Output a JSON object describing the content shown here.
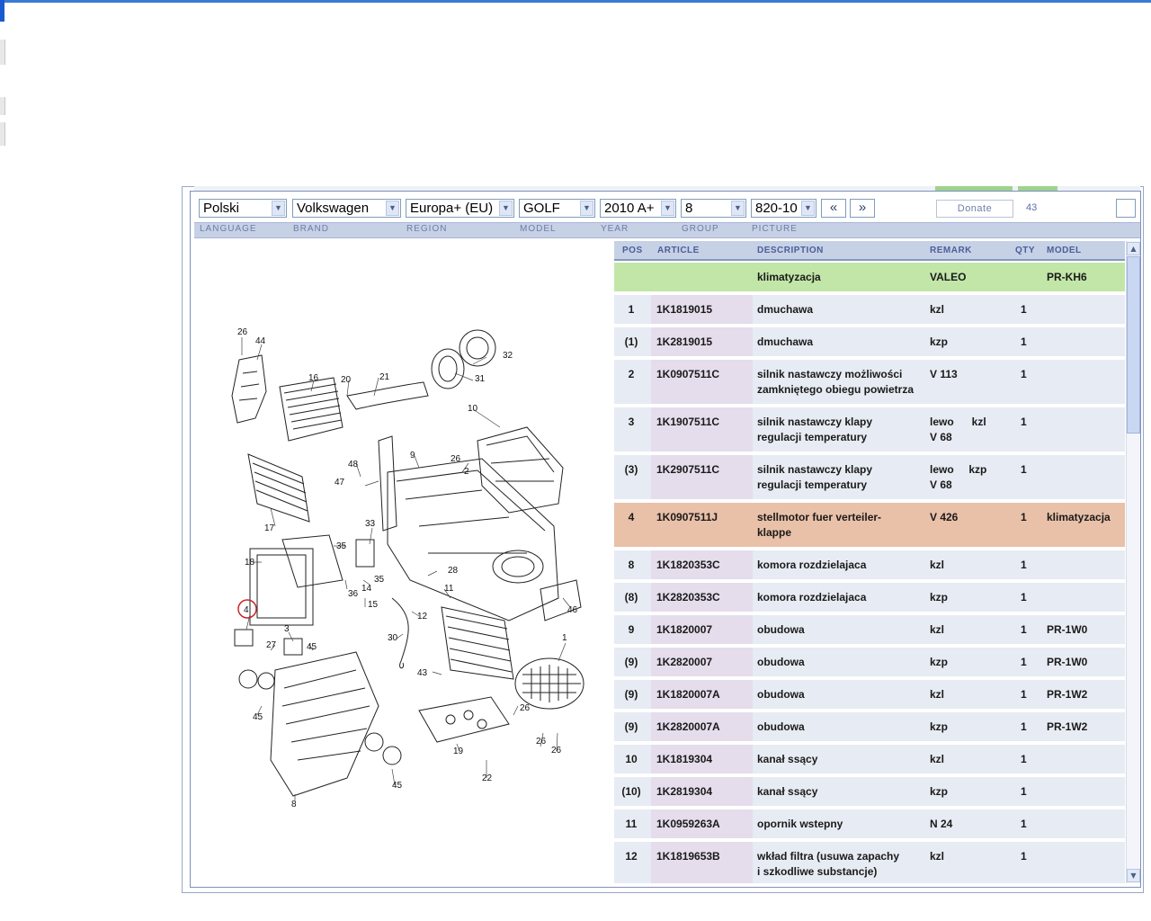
{
  "toolbar": {
    "language": "Polski",
    "brand": "Volkswagen",
    "region": "Europa+ (EU)",
    "model": "GOLF",
    "year": "2010  A+",
    "group": "8",
    "picture": "820-10",
    "prev_label": "«",
    "next_label": "»",
    "donate_label": "Donate",
    "count": "43"
  },
  "labels": {
    "language": "LANGUAGE",
    "brand": "BRAND",
    "region": "REGION",
    "model": "MODEL",
    "year": "YEAR",
    "group": "GROUP",
    "picture": "PICTURE"
  },
  "table": {
    "headers": {
      "pos": "POS",
      "article": "ARTICLE",
      "description": "DESCRIPTION",
      "remark": "REMARK",
      "qty": "QTY",
      "model": "MODEL"
    },
    "rows": [
      {
        "pos": "",
        "article": "",
        "desc1": "klimatyzacja",
        "desc2": "",
        "remark1": "VALEO",
        "remark2": "",
        "qty": "",
        "model": "PR-KH6"
      },
      {
        "pos": "1",
        "article": "1K1819015",
        "desc1": "dmuchawa",
        "desc2": "",
        "remark1": "kzl",
        "remark2": "",
        "qty": "1",
        "model": ""
      },
      {
        "pos": "(1)",
        "article": "1K2819015",
        "desc1": "dmuchawa",
        "desc2": "",
        "remark1": "kzp",
        "remark2": "",
        "qty": "1",
        "model": ""
      },
      {
        "pos": "2",
        "article": "1K0907511C",
        "desc1": "silnik nastawczy możliwości",
        "desc2": "zamkniętego obiegu powietrza",
        "remark1": "V 113",
        "remark2": "",
        "qty": "1",
        "model": ""
      },
      {
        "pos": "3",
        "article": "1K1907511C",
        "desc1": "silnik nastawczy klapy",
        "desc2": "regulacji temperatury",
        "remark1": "lewo      kzl",
        "remark2": "V 68",
        "qty": "1",
        "model": ""
      },
      {
        "pos": "(3)",
        "article": "1K2907511C",
        "desc1": "silnik nastawczy klapy",
        "desc2": "regulacji temperatury",
        "remark1": "lewo     kzp",
        "remark2": "V 68",
        "qty": "1",
        "model": ""
      },
      {
        "pos": "4",
        "article": "1K0907511J",
        "desc1": "stellmotor fuer verteiler-",
        "desc2": "klappe",
        "remark1": "V 426",
        "remark2": "",
        "qty": "1",
        "model": "klimatyzacja"
      },
      {
        "pos": "8",
        "article": "1K1820353C",
        "desc1": "komora rozdzielajaca",
        "desc2": "",
        "remark1": "kzl",
        "remark2": "",
        "qty": "1",
        "model": ""
      },
      {
        "pos": "(8)",
        "article": "1K2820353C",
        "desc1": "komora rozdzielajaca",
        "desc2": "",
        "remark1": "kzp",
        "remark2": "",
        "qty": "1",
        "model": ""
      },
      {
        "pos": "9",
        "article": "1K1820007",
        "desc1": "obudowa",
        "desc2": "",
        "remark1": "kzl",
        "remark2": "",
        "qty": "1",
        "model": "PR-1W0"
      },
      {
        "pos": "(9)",
        "article": "1K2820007",
        "desc1": "obudowa",
        "desc2": "",
        "remark1": "kzp",
        "remark2": "",
        "qty": "1",
        "model": "PR-1W0"
      },
      {
        "pos": "(9)",
        "article": "1K1820007A",
        "desc1": "obudowa",
        "desc2": "",
        "remark1": "kzl",
        "remark2": "",
        "qty": "1",
        "model": "PR-1W2"
      },
      {
        "pos": "(9)",
        "article": "1K2820007A",
        "desc1": "obudowa",
        "desc2": "",
        "remark1": "kzp",
        "remark2": "",
        "qty": "1",
        "model": "PR-1W2"
      },
      {
        "pos": "10",
        "article": "1K1819304",
        "desc1": "kanał ssący",
        "desc2": "",
        "remark1": "kzl",
        "remark2": "",
        "qty": "1",
        "model": ""
      },
      {
        "pos": "(10)",
        "article": "1K2819304",
        "desc1": "kanał ssący",
        "desc2": "",
        "remark1": "kzp",
        "remark2": "",
        "qty": "1",
        "model": ""
      },
      {
        "pos": "11",
        "article": "1K0959263A",
        "desc1": "opornik wstepny",
        "desc2": "",
        "remark1": "N 24",
        "remark2": "",
        "qty": "1",
        "model": ""
      },
      {
        "pos": "12",
        "article": "1K1819653B",
        "desc1": "wkład filtra (usuwa zapachy",
        "desc2": "i szkodliwe substancje)",
        "remark1": "kzl",
        "remark2": "",
        "qty": "1",
        "model": ""
      }
    ]
  },
  "diagram": {
    "callouts": [
      "26",
      "44",
      "16",
      "20",
      "21",
      "32",
      "31",
      "10",
      "9",
      "26",
      "2",
      "47",
      "48",
      "17",
      "33",
      "35",
      "18",
      "28",
      "11",
      "46",
      "4",
      "14",
      "35",
      "36",
      "15",
      "3",
      "27",
      "45",
      "12",
      "30",
      "1",
      "43",
      "26",
      "45",
      "19",
      "26",
      "26",
      "22",
      "45",
      "8"
    ]
  },
  "colors": {
    "row": "#e7ebf3",
    "article_col": "#e5dcec",
    "green_row": "#c2e6a8",
    "highlight_row": "#e9c0a8",
    "header": "#c7d1e6"
  }
}
